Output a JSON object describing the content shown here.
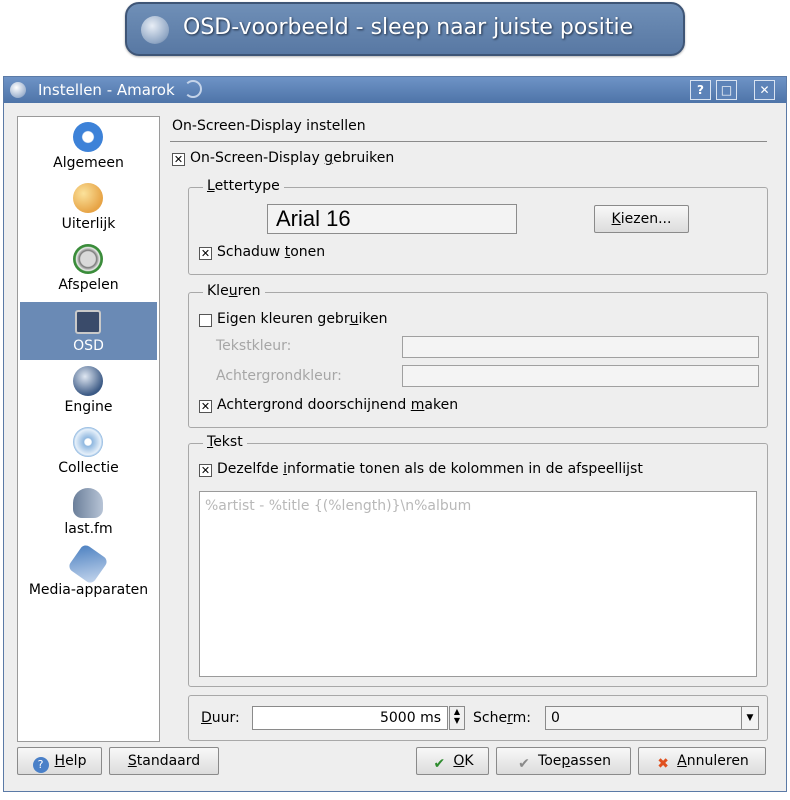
{
  "osd_preview": {
    "text": "OSD-voorbeeld - sleep naar juiste positie"
  },
  "window": {
    "title": "Instellen - Amarok",
    "buttons": {
      "help": "?",
      "maximize": "□",
      "close": "✕"
    }
  },
  "sidebar": {
    "items": [
      {
        "label": "Algemeen",
        "icon": "gear-icon",
        "color": "#3d82d8"
      },
      {
        "label": "Uiterlijk",
        "icon": "palette-icon",
        "color": "#e7a446"
      },
      {
        "label": "Afspelen",
        "icon": "speaker-icon",
        "color": "#3a8c3a"
      },
      {
        "label": "OSD",
        "icon": "tv-icon",
        "color": "#3a4b6a"
      },
      {
        "label": "Engine",
        "icon": "engine-icon",
        "color": "#3c5a85"
      },
      {
        "label": "Collectie",
        "icon": "cds-icon",
        "color": "#90b8e0"
      },
      {
        "label": "last.fm",
        "icon": "head-icon",
        "color": "#6b7f9a"
      },
      {
        "label": "Media-apparaten",
        "icon": "usb-icon",
        "color": "#4a7fc0"
      }
    ],
    "selected": "OSD"
  },
  "page": {
    "title": "On-Screen-Display instellen",
    "use_osd": {
      "label_pre": "On-Screen-Display ",
      "label_u": "g",
      "label_post": "ebruiken",
      "checked": "✕"
    },
    "font_group": {
      "title_u": "L",
      "title_post": "ettertype",
      "font_preview": "Arial 16",
      "choose_button_u": "K",
      "choose_button_post": "iezen...",
      "shadow": {
        "label_pre": "Schaduw ",
        "label_u": "t",
        "label_post": "onen",
        "checked": "✕"
      }
    },
    "colors_group": {
      "title_pre": "Kle",
      "title_u": "u",
      "title_post": "ren",
      "custom_colors": {
        "label_pre": "Eigen kleuren gebr",
        "label_u": "u",
        "label_post": "iken",
        "checked": ""
      },
      "text_color_label": "Tekstkleur:",
      "bg_color_label": "Achtergrondkleur:",
      "translucent": {
        "label_pre": "Achtergrond doorschijnend ",
        "label_u": "m",
        "label_post": "aken",
        "checked": "✕"
      }
    },
    "text_group": {
      "title_u": "T",
      "title_post": "ekst",
      "same_info": {
        "label_pre": "Dezelfde ",
        "label_u": "i",
        "label_post": "nformatie tonen als de kolommen in de afspeellijst",
        "checked": "✕"
      },
      "template_text": "%artist - %title {(%length)}\\n%album"
    },
    "bottom": {
      "duration_label_u": "D",
      "duration_label_post": "uur:",
      "duration_value": "5000 ms",
      "screen_label_pre": "Sche",
      "screen_label_u": "r",
      "screen_label_post": "m:",
      "screen_value": "0"
    }
  },
  "footer": {
    "help_u": "H",
    "help_post": "elp",
    "defaults_u": "S",
    "defaults_post": "tandaard",
    "ok_u": "O",
    "ok_post": "K",
    "apply_pre": "Toe",
    "apply_u": "p",
    "apply_post": "assen",
    "cancel_u": "A",
    "cancel_post": "nnuleren"
  }
}
